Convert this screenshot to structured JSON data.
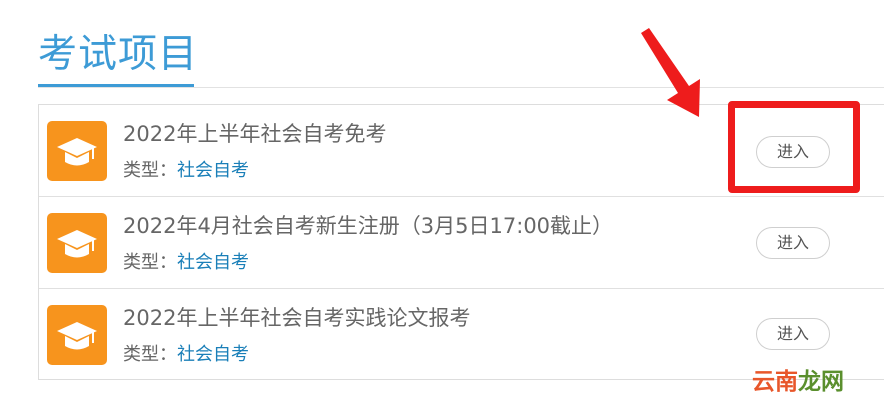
{
  "section": {
    "title": "考试项目"
  },
  "exams": [
    {
      "title": "2022年上半年社会自考免考",
      "type_label": "类型：",
      "type_value": "社会自考",
      "enter_label": "进入"
    },
    {
      "title": "2022年4月社会自考新生注册（3月5日17:00截止）",
      "type_label": "类型：",
      "type_value": "社会自考",
      "enter_label": "进入"
    },
    {
      "title": "2022年上半年社会自考实践论文报考",
      "type_label": "类型：",
      "type_value": "社会自考",
      "enter_label": "进入"
    }
  ],
  "icons": {
    "row_icon": "graduation-cap-icon"
  },
  "colors": {
    "accent": "#3d9bd6",
    "icon_bg": "#f7941d",
    "type_link": "#1a7fb8",
    "annotation": "#ee1c1c"
  },
  "watermark": {
    "part1": "云南",
    "part2": "龙网"
  }
}
